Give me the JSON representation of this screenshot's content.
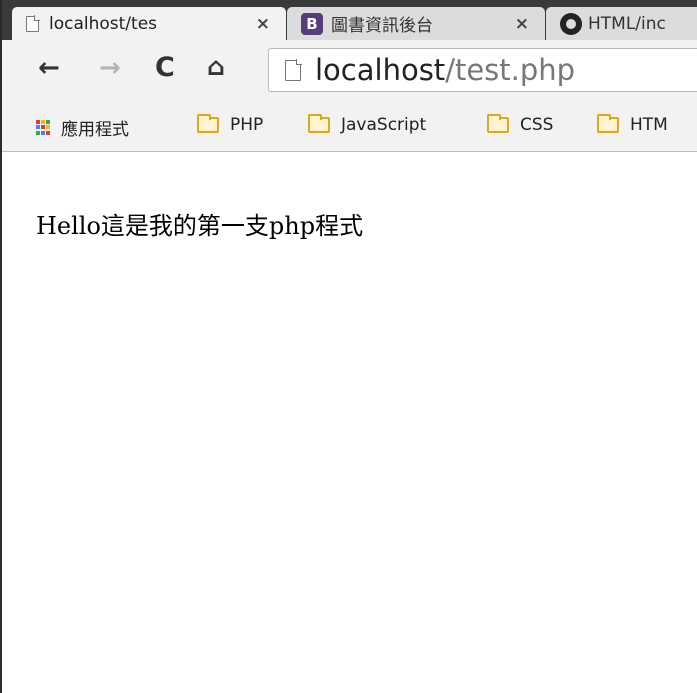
{
  "tabs": [
    {
      "title": "localhost/tes",
      "close": "×",
      "icon": "page-icon",
      "active": true
    },
    {
      "title": "圖書資訊後台",
      "close": "×",
      "icon": "bootstrap-icon",
      "badge": "B",
      "active": false
    },
    {
      "title": "HTML/inc",
      "icon": "github-icon",
      "active": false
    }
  ],
  "toolbar": {
    "back_icon": "←",
    "forward_icon": "→",
    "reload_icon": "C",
    "home_icon": "⌂",
    "url_host": "localhost",
    "url_path": "/test.php"
  },
  "bookmarks": {
    "apps_label": "應用程式",
    "apps_colors": [
      "#e53935",
      "#fbbc05",
      "#34a853",
      "#4285f4",
      "#e53935",
      "#fbbc05",
      "#34a853",
      "#4285f4",
      "#e53935"
    ],
    "items": [
      {
        "label": "PHP",
        "icon": "folder-icon"
      },
      {
        "label": "JavaScript",
        "icon": "folder-icon"
      },
      {
        "label": "CSS",
        "icon": "folder-icon"
      },
      {
        "label": "HTM",
        "icon": "folder-icon"
      }
    ]
  },
  "page": {
    "text": "Hello這是我的第一支php程式"
  },
  "colors": {
    "tabstrip": "#3a3a3a",
    "toolbar": "#f2f2f2",
    "folder": "#e0a61f",
    "bootstrap": "#563d7c"
  }
}
